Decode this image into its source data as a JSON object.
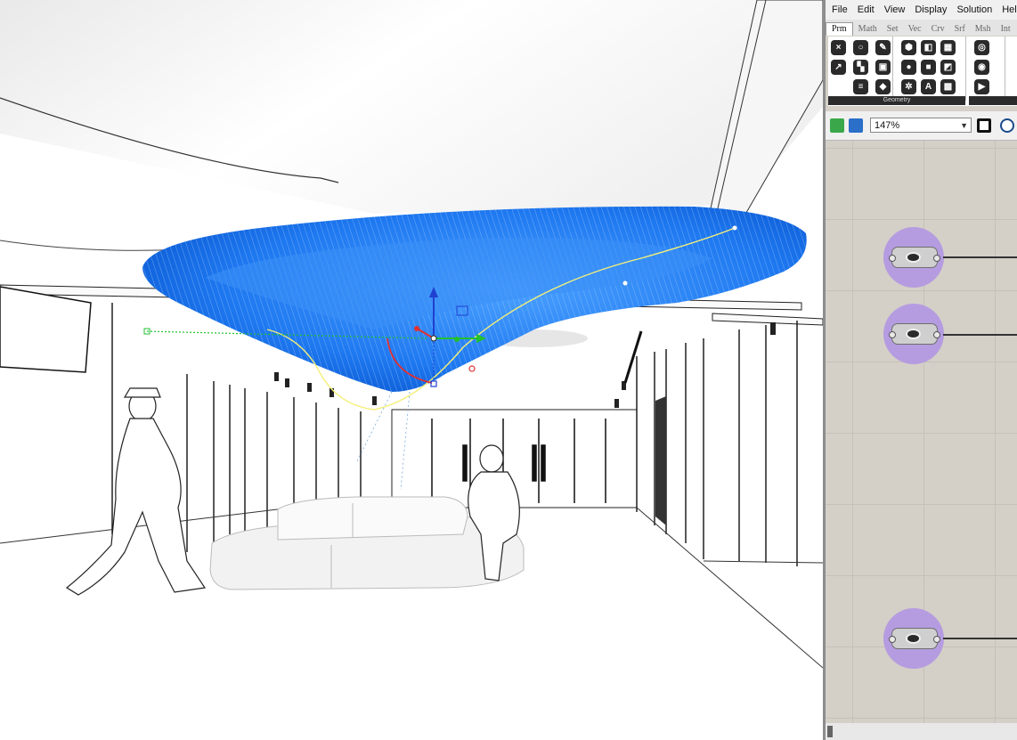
{
  "menu": {
    "items": [
      "File",
      "Edit",
      "View",
      "Display",
      "Solution",
      "Help"
    ]
  },
  "tabs": {
    "items": [
      "Prm",
      "Math",
      "Set",
      "Vec",
      "Crv",
      "Srf",
      "Msh",
      "Int"
    ],
    "active": "Prm"
  },
  "ribbon": {
    "group_label": "Geometry"
  },
  "toolbar": {
    "zoom": "147%"
  },
  "colors": {
    "ceiling_mesh": "#1e78f0",
    "node_fill": "#b59ce0",
    "canvas_bg": "#d4d0c8",
    "gumball_x": "#e03030",
    "gumball_y": "#22c030",
    "gumball_z": "#2040d0"
  },
  "nodes": [
    {
      "icon": "spiral-geometry-icon"
    },
    {
      "icon": "hex-nut-geometry-icon"
    },
    {
      "icon": "ring-geometry-icon"
    }
  ]
}
